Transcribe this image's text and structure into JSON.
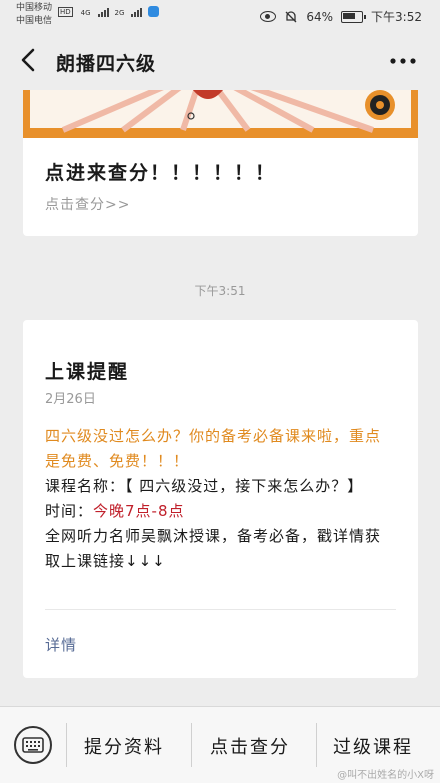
{
  "status": {
    "carrier1": "中国移动",
    "carrier2": "中国电信",
    "net1": "4G",
    "net2": "2G",
    "battery": "64%",
    "time": "下午3:52"
  },
  "nav": {
    "title": "朗播四六级"
  },
  "card1": {
    "title": "点进来查分！！！！！！",
    "link": "点击查分>>"
  },
  "time_separator": "下午3:51",
  "card2": {
    "title": "上课提醒",
    "date": "2月26日",
    "intro": "四六级没过怎么办？你的备考必备课来啦，重点是免费、免费！！！",
    "course_label": "课程名称：",
    "course_value": "【 四六级没过，接下来怎么办？】",
    "time_label": "时间：",
    "time_value": "今晚7点-8点",
    "desc": "全网听力名师吴飘沐授课，备考必备，戳详情获取上课链接↓↓↓",
    "detail": "详情"
  },
  "bottom_menu": {
    "items": [
      "提分资料",
      "点击查分",
      "过级课程"
    ]
  },
  "watermark": "@叫不出姓名的小X呀",
  "colors": {
    "orange": "#e08a1f",
    "red": "#c0202b",
    "link_blue": "#576b95"
  }
}
